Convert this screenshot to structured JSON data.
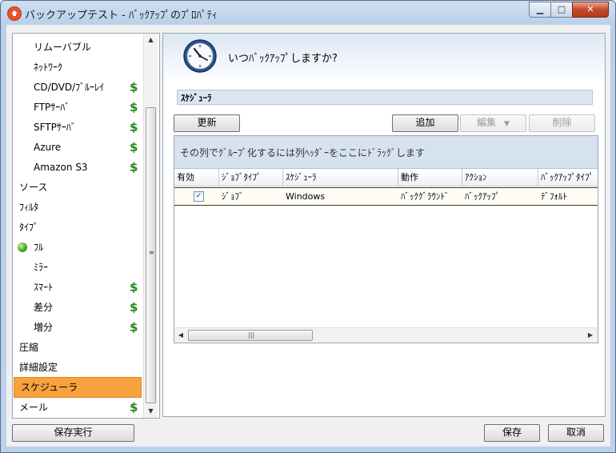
{
  "window": {
    "title": "バックアップテスト - ﾊﾞｯｸｱｯﾌﾟのﾌﾟﾛﾊﾟﾃｨ",
    "minimize_glyph": "▁",
    "maximize_glyph": "□",
    "close_glyph": "✕"
  },
  "sidebar": {
    "items": [
      {
        "label": "リムーバブル",
        "paid": false
      },
      {
        "label": "ﾈｯﾄﾜｰｸ",
        "paid": false
      },
      {
        "label": "CD/DVD/ﾌﾞﾙｰﾚｲ",
        "paid": true
      },
      {
        "label": "FTPｻｰﾊﾞ",
        "paid": true
      },
      {
        "label": "SFTPｻｰﾊﾞ",
        "paid": true
      },
      {
        "label": "Azure",
        "paid": true
      },
      {
        "label": "Amazon S3",
        "paid": true
      },
      {
        "label": "ソース",
        "paid": false
      },
      {
        "label": "ﾌｨﾙﾀ",
        "paid": false
      },
      {
        "label": "ﾀｲﾌﾟ",
        "paid": false
      },
      {
        "label": "ﾌﾙ",
        "paid": false
      },
      {
        "label": "ﾐﾗｰ",
        "paid": false
      },
      {
        "label": "ｽﾏｰﾄ",
        "paid": true
      },
      {
        "label": "差分",
        "paid": true
      },
      {
        "label": "増分",
        "paid": true
      },
      {
        "label": "圧縮",
        "paid": false
      },
      {
        "label": "詳細設定",
        "paid": false
      },
      {
        "label": "スケジューラ",
        "paid": false
      },
      {
        "label": "メール",
        "paid": true
      }
    ],
    "dollar_glyph": "$",
    "scroll_up_glyph": "▲",
    "scroll_down_glyph": "▼",
    "scroll_grip_glyph": "≡"
  },
  "main": {
    "question": "いつﾊﾞｯｸｱｯﾌﾟしますか?",
    "section_title": "ｽｹｼﾞｭｰﾗ",
    "buttons": {
      "refresh": "更新",
      "add": "追加",
      "edit": "編集",
      "delete": "削除",
      "dropdown_glyph": "▼"
    },
    "grid": {
      "group_hint": "その列でｸﾞﾙｰﾌﾟ化するには列ﾍｯﾀﾞｰをここにﾄﾞﾗｯｸﾞします",
      "columns": [
        "有効",
        "ｼﾞｮﾌﾞﾀｲﾌﾟ",
        "ｽｹｼﾞｭｰﾗ",
        "動作",
        "ｱｸｼｮﾝ",
        "ﾊﾞｯｸｱｯﾌﾟﾀｲﾌﾟ"
      ],
      "rows": [
        {
          "enabled": true,
          "job_type": "ｼﾞｮﾌﾞ",
          "scheduler": "Windows",
          "behavior": "ﾊﾞｯｸｸﾞﾗｳﾝﾄﾞ",
          "action": "ﾊﾞｯｸｱｯﾌﾟ",
          "backup_type": "ﾃﾞﾌｫﾙﾄ"
        }
      ],
      "check_glyph": "✓",
      "scroll_left_glyph": "◀",
      "scroll_right_glyph": "▶",
      "scroll_grip_glyph": "|||"
    }
  },
  "footer": {
    "save_and_run": "保存実行",
    "save": "保存",
    "cancel": "取消"
  },
  "colors": {
    "selected_item": "#f7a23c",
    "paid_indicator": "#1f8a1f",
    "section_band": "#dce6f2"
  },
  "selected_sidebar_index": 17
}
